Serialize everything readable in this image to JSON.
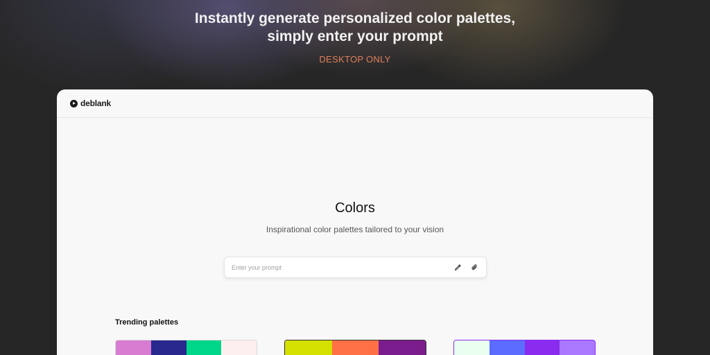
{
  "hero": {
    "title_line1": "Instantly generate personalized color palettes,",
    "title_line2": "simply enter your prompt",
    "subtitle": "DESKTOP ONLY"
  },
  "app": {
    "logo_text": "deblank",
    "title": "Colors",
    "subtitle": "Inspirational color palettes tailored to your vision",
    "prompt": {
      "placeholder": "Enter your prompt",
      "value": "",
      "icons": [
        "eyedropper-icon",
        "paperclip-icon"
      ]
    },
    "trending_heading": "Trending palettes",
    "palettes": [
      {
        "colors": [
          "#d77cd0",
          "#28288f",
          "#00d68a",
          "#fdeef0"
        ]
      },
      {
        "colors": [
          "#d3e000",
          "#ff7046",
          "#7b1c8c"
        ]
      },
      {
        "colors": [
          "#eafff0",
          "#5b6cff",
          "#8a2cf0",
          "#a978ff"
        ]
      }
    ]
  },
  "colors": {
    "page_bg": "#262626",
    "accent": "#e0805c",
    "window_bg": "#f8f8f8"
  }
}
